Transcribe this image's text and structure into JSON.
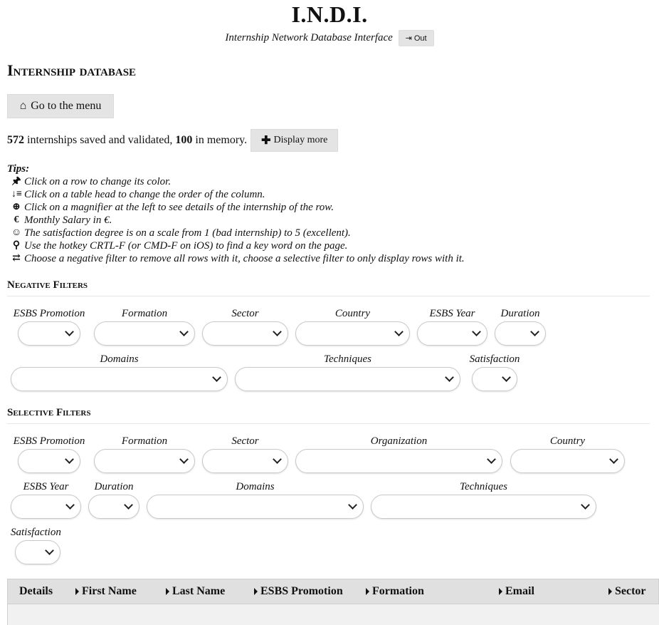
{
  "header": {
    "title": "I.N.D.I.",
    "subtitle": "Internship Network Database Interface",
    "out_label": "Out",
    "out_icon": "sign-out-icon"
  },
  "page": {
    "title": "Internship database",
    "menu_button": "Go to the menu",
    "menu_icon": "home-icon"
  },
  "counts": {
    "saved": "572",
    "saved_text": "internships saved and validated,",
    "memory": "100",
    "memory_text": "in memory.",
    "display_more": "Display more"
  },
  "tips": {
    "title": "Tips:",
    "items": [
      {
        "icon": "pin-icon",
        "text": "Click on a row to change its color."
      },
      {
        "icon": "sort-icon",
        "text": "Click on a table head to change the order of the column."
      },
      {
        "icon": "magnifier-plus-icon",
        "text": "Click on a magnifier at the left to see details of the internship of the row."
      },
      {
        "icon": "euro-icon",
        "text": "Monthly Salary in €."
      },
      {
        "icon": "smile-icon",
        "text": "The satisfaction degree is on a scale from 1 (bad internship) to 5 (excellent)."
      },
      {
        "icon": "search-icon",
        "text": "Use the hotkey CRTL-F (or CMD-F on iOS) to find a key word on the page."
      },
      {
        "icon": "exchange-icon",
        "text": "Choose a negative filter to remove all rows with it, choose a selective filter to only display rows with it."
      }
    ]
  },
  "negative_filters": {
    "title": "Negative Filters",
    "labels": [
      "ESBS Promotion",
      "Formation",
      "Sector",
      "Country",
      "ESBS Year",
      "Duration",
      "Domains",
      "Techniques",
      "Satisfaction"
    ]
  },
  "selective_filters": {
    "title": "Selective Filters",
    "labels": [
      "ESBS Promotion",
      "Formation",
      "Sector",
      "Organization",
      "Country",
      "ESBS Year",
      "Duration",
      "Domains",
      "Techniques",
      "Satisfaction"
    ]
  },
  "table": {
    "columns": [
      "Details",
      "First Name",
      "Last Name",
      "ESBS Promotion",
      "Formation",
      "Email",
      "Sector"
    ]
  }
}
